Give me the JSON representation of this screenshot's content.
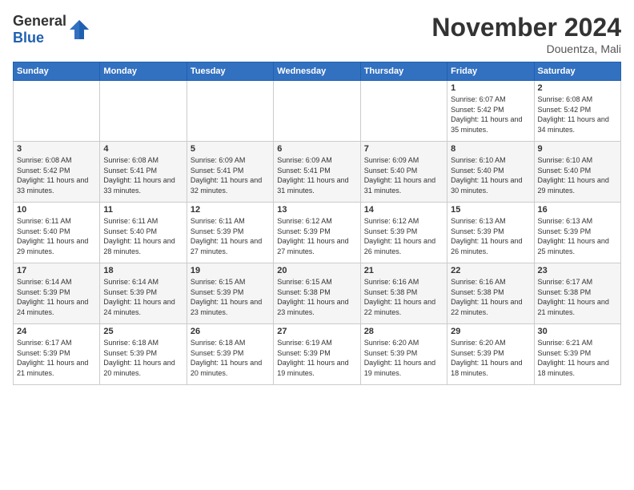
{
  "app": {
    "name_general": "General",
    "name_blue": "Blue"
  },
  "header": {
    "month_title": "November 2024",
    "location": "Douentza, Mali"
  },
  "days_of_week": [
    "Sunday",
    "Monday",
    "Tuesday",
    "Wednesday",
    "Thursday",
    "Friday",
    "Saturday"
  ],
  "weeks": [
    [
      {
        "day": "",
        "info": ""
      },
      {
        "day": "",
        "info": ""
      },
      {
        "day": "",
        "info": ""
      },
      {
        "day": "",
        "info": ""
      },
      {
        "day": "",
        "info": ""
      },
      {
        "day": "1",
        "info": "Sunrise: 6:07 AM\nSunset: 5:42 PM\nDaylight: 11 hours and 35 minutes."
      },
      {
        "day": "2",
        "info": "Sunrise: 6:08 AM\nSunset: 5:42 PM\nDaylight: 11 hours and 34 minutes."
      }
    ],
    [
      {
        "day": "3",
        "info": "Sunrise: 6:08 AM\nSunset: 5:42 PM\nDaylight: 11 hours and 33 minutes."
      },
      {
        "day": "4",
        "info": "Sunrise: 6:08 AM\nSunset: 5:41 PM\nDaylight: 11 hours and 33 minutes."
      },
      {
        "day": "5",
        "info": "Sunrise: 6:09 AM\nSunset: 5:41 PM\nDaylight: 11 hours and 32 minutes."
      },
      {
        "day": "6",
        "info": "Sunrise: 6:09 AM\nSunset: 5:41 PM\nDaylight: 11 hours and 31 minutes."
      },
      {
        "day": "7",
        "info": "Sunrise: 6:09 AM\nSunset: 5:40 PM\nDaylight: 11 hours and 31 minutes."
      },
      {
        "day": "8",
        "info": "Sunrise: 6:10 AM\nSunset: 5:40 PM\nDaylight: 11 hours and 30 minutes."
      },
      {
        "day": "9",
        "info": "Sunrise: 6:10 AM\nSunset: 5:40 PM\nDaylight: 11 hours and 29 minutes."
      }
    ],
    [
      {
        "day": "10",
        "info": "Sunrise: 6:11 AM\nSunset: 5:40 PM\nDaylight: 11 hours and 29 minutes."
      },
      {
        "day": "11",
        "info": "Sunrise: 6:11 AM\nSunset: 5:40 PM\nDaylight: 11 hours and 28 minutes."
      },
      {
        "day": "12",
        "info": "Sunrise: 6:11 AM\nSunset: 5:39 PM\nDaylight: 11 hours and 27 minutes."
      },
      {
        "day": "13",
        "info": "Sunrise: 6:12 AM\nSunset: 5:39 PM\nDaylight: 11 hours and 27 minutes."
      },
      {
        "day": "14",
        "info": "Sunrise: 6:12 AM\nSunset: 5:39 PM\nDaylight: 11 hours and 26 minutes."
      },
      {
        "day": "15",
        "info": "Sunrise: 6:13 AM\nSunset: 5:39 PM\nDaylight: 11 hours and 26 minutes."
      },
      {
        "day": "16",
        "info": "Sunrise: 6:13 AM\nSunset: 5:39 PM\nDaylight: 11 hours and 25 minutes."
      }
    ],
    [
      {
        "day": "17",
        "info": "Sunrise: 6:14 AM\nSunset: 5:39 PM\nDaylight: 11 hours and 24 minutes."
      },
      {
        "day": "18",
        "info": "Sunrise: 6:14 AM\nSunset: 5:39 PM\nDaylight: 11 hours and 24 minutes."
      },
      {
        "day": "19",
        "info": "Sunrise: 6:15 AM\nSunset: 5:39 PM\nDaylight: 11 hours and 23 minutes."
      },
      {
        "day": "20",
        "info": "Sunrise: 6:15 AM\nSunset: 5:38 PM\nDaylight: 11 hours and 23 minutes."
      },
      {
        "day": "21",
        "info": "Sunrise: 6:16 AM\nSunset: 5:38 PM\nDaylight: 11 hours and 22 minutes."
      },
      {
        "day": "22",
        "info": "Sunrise: 6:16 AM\nSunset: 5:38 PM\nDaylight: 11 hours and 22 minutes."
      },
      {
        "day": "23",
        "info": "Sunrise: 6:17 AM\nSunset: 5:38 PM\nDaylight: 11 hours and 21 minutes."
      }
    ],
    [
      {
        "day": "24",
        "info": "Sunrise: 6:17 AM\nSunset: 5:39 PM\nDaylight: 11 hours and 21 minutes."
      },
      {
        "day": "25",
        "info": "Sunrise: 6:18 AM\nSunset: 5:39 PM\nDaylight: 11 hours and 20 minutes."
      },
      {
        "day": "26",
        "info": "Sunrise: 6:18 AM\nSunset: 5:39 PM\nDaylight: 11 hours and 20 minutes."
      },
      {
        "day": "27",
        "info": "Sunrise: 6:19 AM\nSunset: 5:39 PM\nDaylight: 11 hours and 19 minutes."
      },
      {
        "day": "28",
        "info": "Sunrise: 6:20 AM\nSunset: 5:39 PM\nDaylight: 11 hours and 19 minutes."
      },
      {
        "day": "29",
        "info": "Sunrise: 6:20 AM\nSunset: 5:39 PM\nDaylight: 11 hours and 18 minutes."
      },
      {
        "day": "30",
        "info": "Sunrise: 6:21 AM\nSunset: 5:39 PM\nDaylight: 11 hours and 18 minutes."
      }
    ]
  ]
}
